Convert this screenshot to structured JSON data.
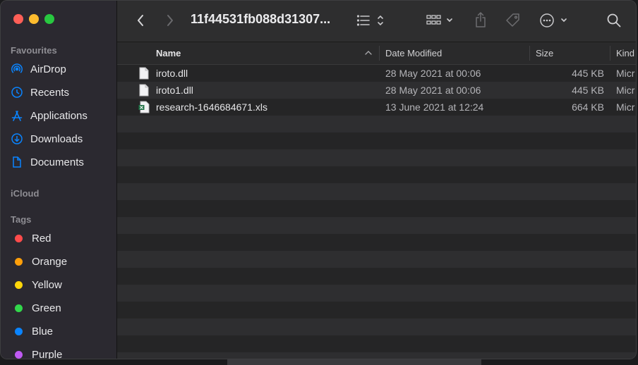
{
  "window": {
    "title": "11f44531fb088d31307..."
  },
  "sidebar": {
    "favourites_label": "Favourites",
    "favourites": [
      {
        "label": "AirDrop",
        "icon": "airdrop-icon"
      },
      {
        "label": "Recents",
        "icon": "clock-icon"
      },
      {
        "label": "Applications",
        "icon": "applications-icon"
      },
      {
        "label": "Downloads",
        "icon": "download-icon"
      },
      {
        "label": "Documents",
        "icon": "document-icon"
      }
    ],
    "icloud_label": "iCloud",
    "tags_label": "Tags",
    "tags": [
      {
        "label": "Red",
        "color": "#ff4b4b"
      },
      {
        "label": "Orange",
        "color": "#ff9f0a"
      },
      {
        "label": "Yellow",
        "color": "#ffd60a"
      },
      {
        "label": "Green",
        "color": "#32d74b"
      },
      {
        "label": "Blue",
        "color": "#0a84ff"
      },
      {
        "label": "Purple",
        "color": "#bf5af2"
      }
    ]
  },
  "columns": {
    "name": "Name",
    "date": "Date Modified",
    "size": "Size",
    "kind": "Kind"
  },
  "files": [
    {
      "name": "iroto.dll",
      "date": "28 May 2021 at 00:06",
      "size": "445 KB",
      "kind": "Micr",
      "icon": "file-icon"
    },
    {
      "name": "iroto1.dll",
      "date": "28 May 2021 at 00:06",
      "size": "445 KB",
      "kind": "Micr",
      "icon": "file-icon"
    },
    {
      "name": "research-1646684671.xls",
      "date": "13 June 2021 at 12:24",
      "size": "664 KB",
      "kind": "Micr",
      "icon": "excel-file-icon"
    }
  ],
  "colors": {
    "accent": "#0a84ff",
    "sidebar_bg": "#2b2930",
    "content_bg": "#252526"
  }
}
